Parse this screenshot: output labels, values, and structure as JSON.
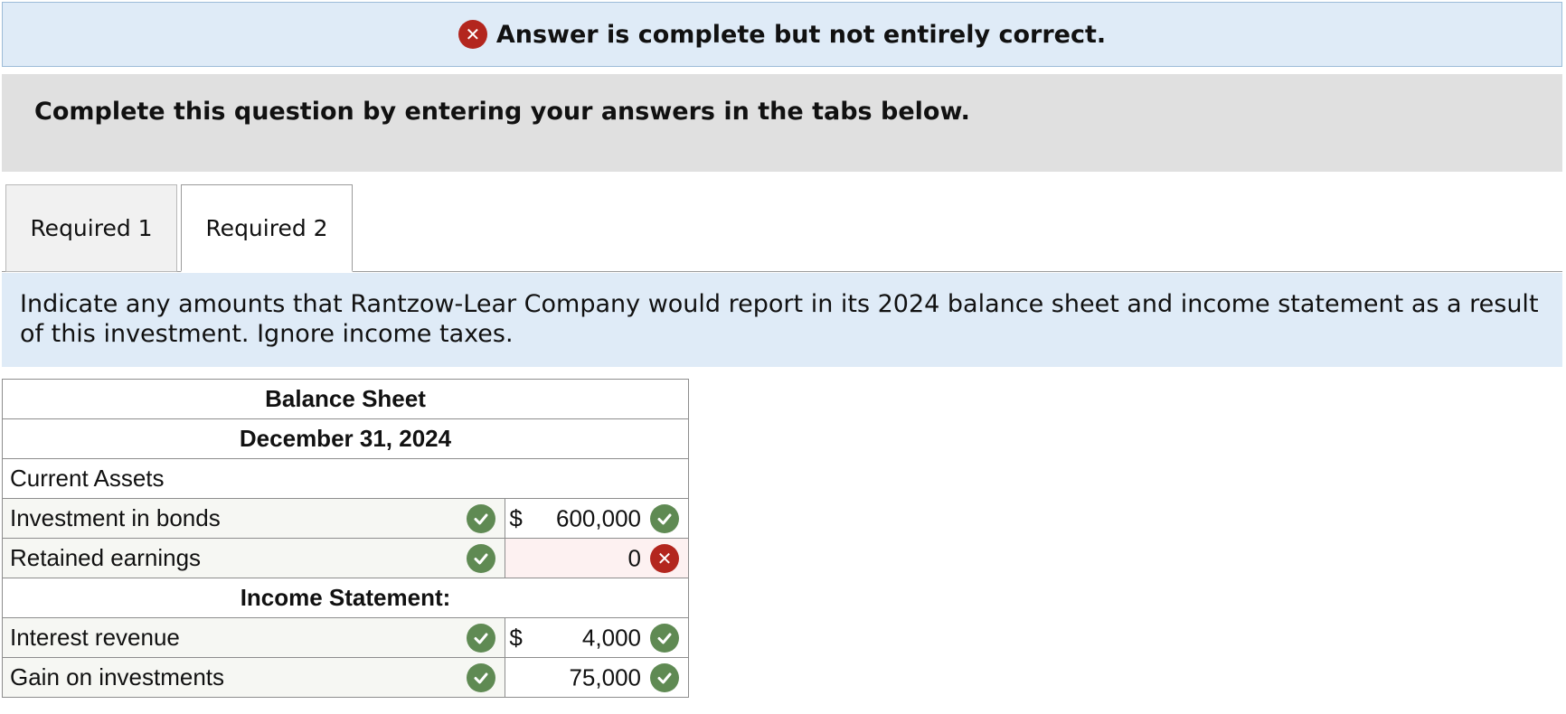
{
  "banner": {
    "text": "Answer is complete but not entirely correct.",
    "icon": "x-circle-icon"
  },
  "instructions": {
    "text": "Complete this question by entering your answers in the tabs below."
  },
  "tabs": [
    {
      "label": "Required 1",
      "active": false
    },
    {
      "label": "Required 2",
      "active": true
    }
  ],
  "prompt": {
    "text": "Indicate any amounts that Rantzow-Lear Company would report in its 2024 balance sheet and income statement as a result of this investment. Ignore income taxes."
  },
  "statement": {
    "title": "Balance Sheet",
    "date": "December 31, 2024",
    "current_assets_label": "Current Assets",
    "income_statement_label": "Income Statement:",
    "rows": [
      {
        "label": "Investment in bonds",
        "currency": "$",
        "amount": "600,000",
        "label_status": "correct",
        "amount_status": "correct"
      },
      {
        "label": "Retained earnings",
        "currency": "",
        "amount": "0",
        "label_status": "correct",
        "amount_status": "incorrect"
      },
      {
        "label": "Interest revenue",
        "currency": "$",
        "amount": "4,000",
        "label_status": "correct",
        "amount_status": "correct"
      },
      {
        "label": "Gain on investments",
        "currency": "",
        "amount": "75,000",
        "label_status": "correct",
        "amount_status": "correct"
      }
    ]
  },
  "colors": {
    "banner_bg": "#dfebf7",
    "correct_green": "#5f8a53",
    "incorrect_red": "#b3261e"
  }
}
